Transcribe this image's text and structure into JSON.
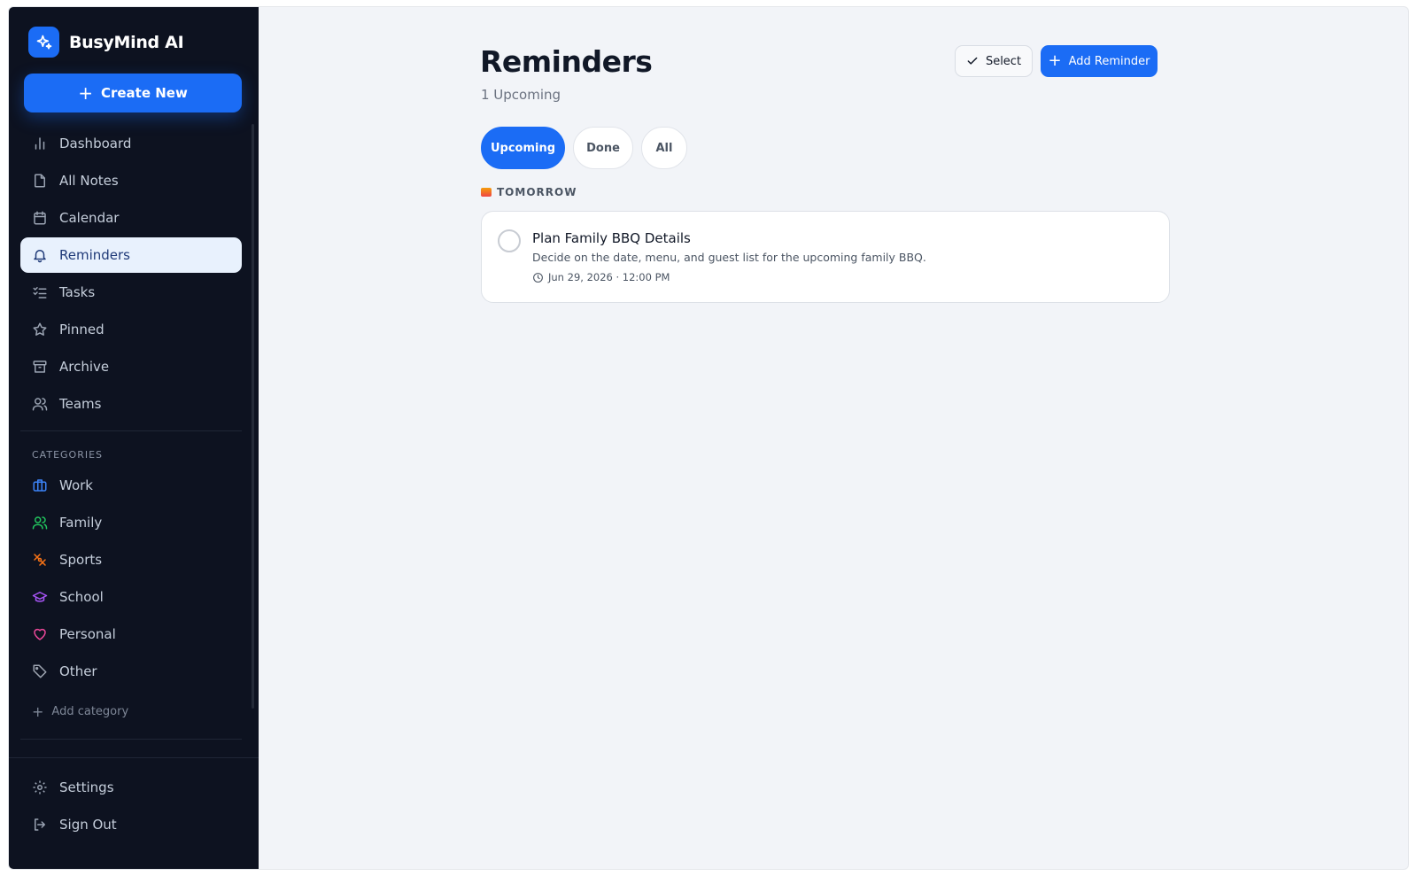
{
  "brand": {
    "name": "BusyMind AI",
    "logo_icon": "sparkles-icon"
  },
  "sidebar": {
    "create_label": "Create New",
    "nav": [
      {
        "label": "Dashboard",
        "icon": "bar-chart-icon"
      },
      {
        "label": "All Notes",
        "icon": "file-icon"
      },
      {
        "label": "Calendar",
        "icon": "calendar-icon"
      },
      {
        "label": "Reminders",
        "icon": "bell-icon",
        "active": true
      },
      {
        "label": "Tasks",
        "icon": "checklist-icon"
      },
      {
        "label": "Pinned",
        "icon": "star-icon"
      },
      {
        "label": "Archive",
        "icon": "archive-icon"
      },
      {
        "label": "Teams",
        "icon": "users-icon"
      }
    ],
    "categories_title": "CATEGORIES",
    "categories": [
      {
        "label": "Work",
        "icon": "briefcase-icon",
        "color": "#3b82f6"
      },
      {
        "label": "Family",
        "icon": "users-icon",
        "color": "#22c55e"
      },
      {
        "label": "Sports",
        "icon": "sports-icon",
        "color": "#f97316"
      },
      {
        "label": "School",
        "icon": "graduation-cap-icon",
        "color": "#a855f7"
      },
      {
        "label": "Personal",
        "icon": "heart-icon",
        "color": "#ec4899"
      },
      {
        "label": "Other",
        "icon": "tag-icon",
        "color": "#9ca3af"
      }
    ],
    "add_category_label": "Add category",
    "bottom": [
      {
        "label": "Settings",
        "icon": "gear-icon"
      },
      {
        "label": "Sign Out",
        "icon": "sign-out-icon"
      }
    ]
  },
  "main": {
    "title": "Reminders",
    "subtitle": "1 Upcoming",
    "select_label": "Select",
    "add_label": "Add Reminder",
    "tabs": [
      {
        "label": "Upcoming",
        "active": true
      },
      {
        "label": "Done"
      },
      {
        "label": "All"
      }
    ],
    "group_label": "TOMORROW",
    "reminders": [
      {
        "title": "Plan Family BBQ Details",
        "description": "Decide on the date, menu, and guest list for the upcoming family BBQ.",
        "datetime": "Jun 29, 2026 · 12:00 PM"
      }
    ]
  },
  "colors": {
    "accent": "#1b6cf5",
    "sidebar_bg": "#0d1220",
    "page_bg": "#f2f4f8"
  }
}
